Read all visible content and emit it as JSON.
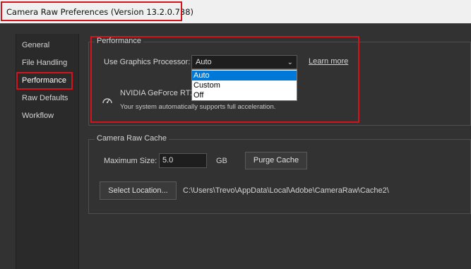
{
  "window": {
    "title": "Camera Raw Preferences  (Version 13.2.0.738)"
  },
  "sidebar": {
    "items": [
      {
        "label": "General"
      },
      {
        "label": "File Handling"
      },
      {
        "label": "Performance"
      },
      {
        "label": "Raw Defaults"
      },
      {
        "label": "Workflow"
      }
    ],
    "selected": "Performance"
  },
  "performance": {
    "group_title": "Performance",
    "gpu_label": "Use Graphics Processor:",
    "gpu_value": "Auto",
    "dropdown_options": [
      "Auto",
      "Custom",
      "Off"
    ],
    "learn_more": "Learn more",
    "gpu_name": "NVIDIA GeForce RTX",
    "gpu_status": "Your system automatically supports full acceleration.",
    "gpu_icon": "speedometer-icon"
  },
  "cache": {
    "group_title": "Camera Raw Cache",
    "max_size_label": "Maximum Size:",
    "max_size_value": "5.0",
    "unit": "GB",
    "purge_button": "Purge Cache",
    "select_location_button": "Select Location...",
    "path": "C:\\Users\\Trevo\\AppData\\Local\\Adobe\\CameraRaw\\Cache2\\"
  },
  "colors": {
    "highlight_box": "#d4141c",
    "selection_blue": "#0078d7",
    "panel_bg": "#323232"
  }
}
